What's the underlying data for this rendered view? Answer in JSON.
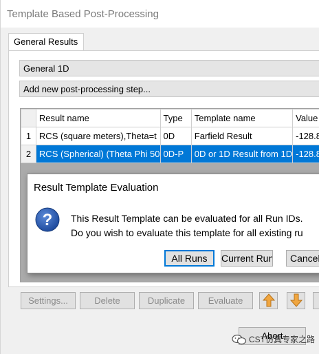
{
  "window": {
    "title": "Template Based Post-Processing"
  },
  "tabs": [
    {
      "label": "General Results"
    }
  ],
  "result_type_select": {
    "value": "General 1D"
  },
  "add_step_select": {
    "value": "Add new post-processing step..."
  },
  "table": {
    "columns": [
      "Result name",
      "Type",
      "Template name",
      "Value"
    ],
    "rows": [
      {
        "num": "1",
        "result_name": "RCS (square meters),Theta=t",
        "type": "0D",
        "template_name": "Farfield Result",
        "value": "-128.8"
      },
      {
        "num": "2",
        "result_name": "RCS (Spherical) (Theta Phi 50",
        "type": "0D-P",
        "template_name": "0D or 1D Result from 1D",
        "value": "-128.8"
      }
    ]
  },
  "buttons": {
    "settings": "Settings...",
    "delete": "Delete",
    "duplicate": "Duplicate",
    "evaluate": "Evaluate",
    "abort": "Abort"
  },
  "dialog": {
    "title": "Result Template Evaluation",
    "message_line1": "This Result Template can be evaluated for all Run IDs.",
    "message_line2": "Do you wish to evaluate this template for all existing ru",
    "buttons": {
      "all_runs": "All Runs",
      "current_run": "Current Run",
      "cancel": "Cancel"
    }
  },
  "watermark": {
    "text": "CST仿真专家之路"
  },
  "colors": {
    "selection": "#0078d7",
    "up_arrow": "#f0a640",
    "down_arrow": "#f0a640"
  }
}
